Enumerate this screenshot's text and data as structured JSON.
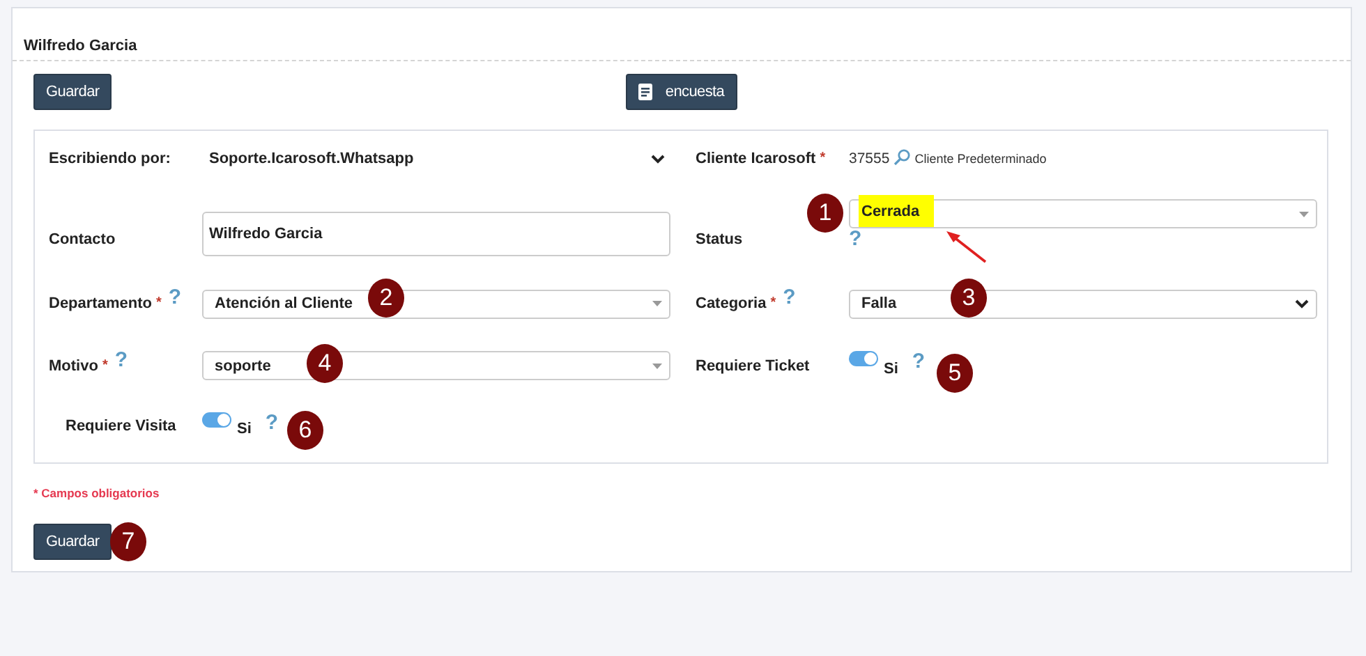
{
  "header": {
    "title": "Wilfredo Garcia"
  },
  "toolbar": [
    {
      "kind": "plain",
      "label": "Guardar"
    },
    {
      "kind": "doc",
      "label": "encuesta"
    }
  ],
  "form_rows": [
    {
      "left": {
        "label": "Escribiendo por:",
        "kind": "plain-select",
        "value": "Soporte.Icarosoft.Whatsapp"
      },
      "right": {
        "label": "Cliente Icarosoft",
        "required_mark": "*",
        "kind": "client",
        "value": "37555",
        "note": "Cliente Predeterminado"
      }
    },
    {
      "left": {
        "label": "Contacto",
        "kind": "input",
        "value": "Wilfredo Garcia"
      },
      "right": {
        "label": "Status",
        "kind": "select",
        "value": "Cerrada",
        "highlighted": true,
        "help_below": "?"
      }
    },
    {
      "left": {
        "label": "Departamento",
        "required_mark": "*",
        "help": "?",
        "kind": "select",
        "value": "Atención al Cliente"
      },
      "right": {
        "label": "Categoria",
        "required_mark": "*",
        "help": "?",
        "kind": "native-select",
        "value": "Falla"
      }
    },
    {
      "left": {
        "label": "Motivo",
        "required_mark": "*",
        "help": "?",
        "kind": "select",
        "value": "soporte"
      },
      "right": {
        "label": "Requiere Ticket",
        "kind": "toggle",
        "on": true,
        "value": "Si",
        "help_after": "?"
      }
    },
    {
      "left": {
        "label": "Requiere Visita",
        "kind": "toggle",
        "on": true,
        "value": "Si",
        "help_after": "?",
        "indent": true
      }
    }
  ],
  "required_note": "* Campos obligatorios",
  "footer_button": {
    "label": "Guardar"
  },
  "annotations": [
    {
      "label": "1"
    },
    {
      "label": "2"
    },
    {
      "label": "3"
    },
    {
      "label": "4"
    },
    {
      "label": "5"
    },
    {
      "label": "6"
    },
    {
      "label": "7"
    }
  ]
}
